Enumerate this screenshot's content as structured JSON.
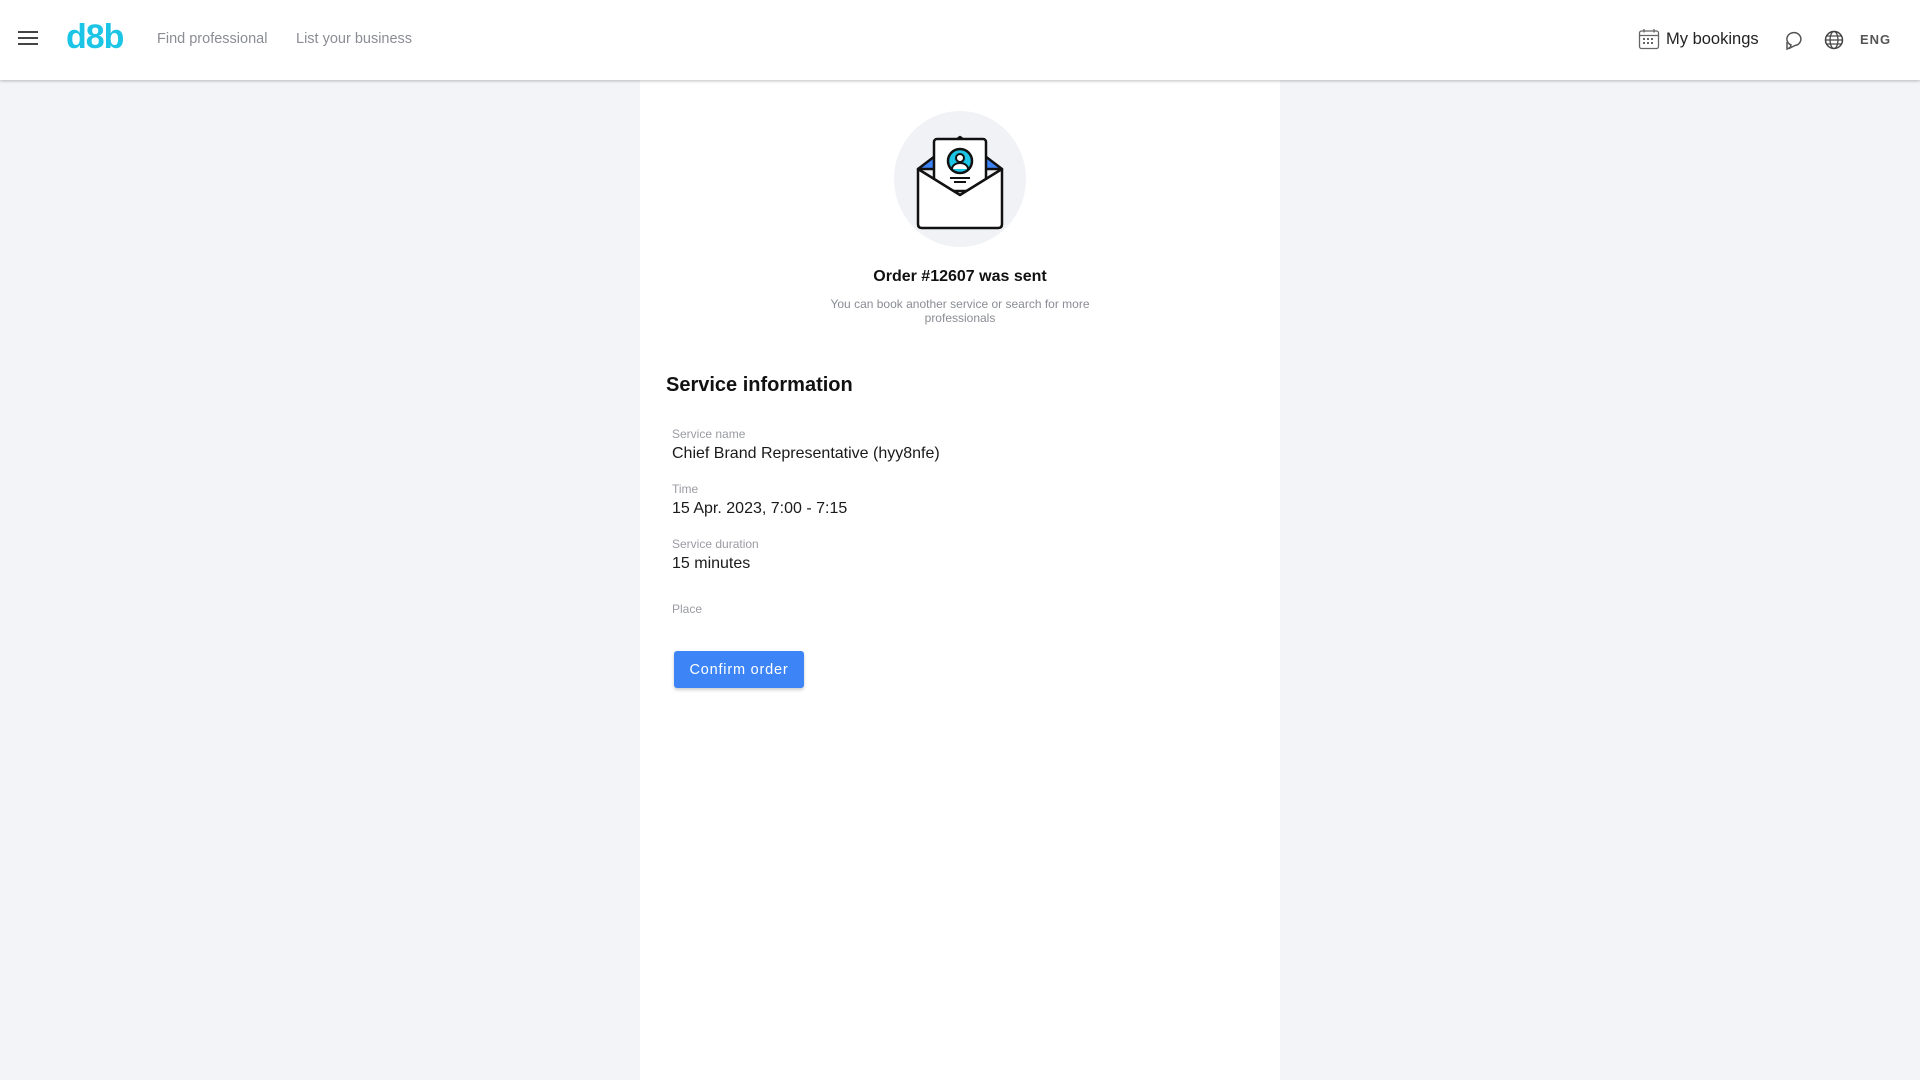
{
  "header": {
    "logo": "d8b",
    "nav": [
      "Find professional",
      "List your business"
    ],
    "my_bookings": "My bookings",
    "language": "ENG"
  },
  "confirmation": {
    "title": "Order #12607 was sent",
    "subtitle": "You can book another service or search for more professionals"
  },
  "service": {
    "heading": "Service information",
    "fields": [
      {
        "label": "Service name",
        "value": "Chief Brand Representative (hyy8nfe)"
      },
      {
        "label": "Time",
        "value": "15 Apr. 2023, 7:00 - 7:15"
      },
      {
        "label": "Service duration",
        "value": "15 minutes"
      },
      {
        "label": "Place",
        "value": ""
      }
    ],
    "confirm_label": "Confirm order"
  },
  "colors": {
    "brand": "#1cc5e6",
    "primary": "#3d85f7"
  }
}
